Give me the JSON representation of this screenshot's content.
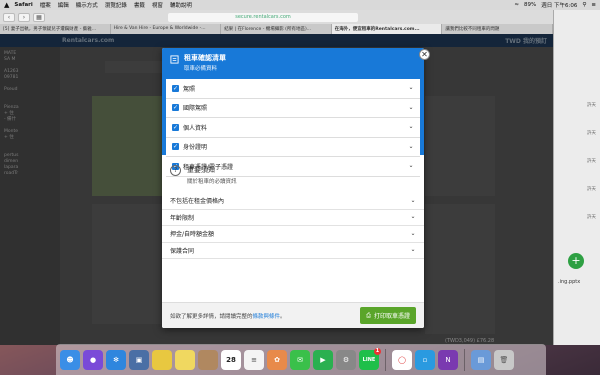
{
  "menubar": {
    "apple": "",
    "app": "Safari",
    "items": [
      "檔案",
      "編輯",
      "顯示方式",
      "瀏覽記錄",
      "書籤",
      "視窗",
      "輔助說明"
    ],
    "battery": "89%",
    "datetime": "週日 下午6:06"
  },
  "browser": {
    "url": "secure.rentalcars.com",
    "tabs": [
      "[5] 妻子出軌，男子懷疑兒子遭竊財產 - 藝雅...",
      "Hire & Van Hire - Europe & Worldwide -...",
      "結果 | 在Florence - 機場攝影 (所有地區)...",
      "在海外，便宜租車的Rentalcars.com...",
      "讓我們比較不同租車的問題"
    ],
    "active_tab": 3
  },
  "site": {
    "logo": "Rentalcars.com",
    "currency": "TWD 我的預訂",
    "left_text": [
      "MATE",
      "SA M",
      "A1263",
      "09781",
      "Pseud",
      "Pienza",
      "+ 住",
      "- 備什",
      "Monte",
      "+ 住",
      "pertus",
      "dimen",
      "lapara",
      "roadTr"
    ],
    "total": "(TWD3,049) £76.28"
  },
  "modal": {
    "header_title": "租車確認清單",
    "header_subtitle": "取車必備資料",
    "checklist": [
      {
        "label": "駕照"
      },
      {
        "label": "國際駕照"
      },
      {
        "label": "個人資料"
      },
      {
        "label": "身份證明"
      },
      {
        "label": "租車憑證/電子憑證"
      }
    ],
    "notice_title": "重要須知",
    "notice_subtitle": "關於租車的必讀資訊",
    "info_items": [
      {
        "label": "不包括在租金價格內"
      },
      {
        "label": "年齡限制"
      },
      {
        "label": "押金/自時額金額"
      },
      {
        "label": "保護合同"
      }
    ],
    "footer_text": "如欲了解更多詳情，請閱讀完整的",
    "footer_link": "條款與條件",
    "footer_tail": "。",
    "print_button": "打印取車憑證",
    "close": "✕"
  },
  "right_window": {
    "rows": [
      "許天",
      "許天",
      "許天",
      "許天",
      "許天"
    ],
    "file": ".ing.pptx"
  },
  "dock": {
    "icons": [
      {
        "name": "finder",
        "color": "#3a8ee6"
      },
      {
        "name": "siri",
        "color": "#7a4ad8"
      },
      {
        "name": "safari",
        "color": "#2e86de"
      },
      {
        "name": "preview",
        "color": "#4a6fa5"
      },
      {
        "name": "stickies",
        "color": "#e8c840"
      },
      {
        "name": "notes",
        "color": "#f0d860"
      },
      {
        "name": "contacts",
        "color": "#b08860"
      },
      {
        "name": "calendar",
        "color": "#ffffff"
      },
      {
        "name": "reminders",
        "color": "#f4f4f4"
      },
      {
        "name": "photos",
        "color": "#e88a4a"
      },
      {
        "name": "messages",
        "color": "#3ac04a"
      },
      {
        "name": "facetime",
        "color": "#2ab050"
      },
      {
        "name": "system-preferences",
        "color": "#888888"
      },
      {
        "name": "line",
        "color": "#1fbf4a"
      },
      {
        "name": "chrome",
        "color": "#ffffff"
      },
      {
        "name": "screen",
        "color": "#2a9ae0"
      },
      {
        "name": "onenote",
        "color": "#7a3ab0"
      },
      {
        "name": "folder",
        "color": "#6a9ad8"
      },
      {
        "name": "trash",
        "color": "#c8c8c8"
      }
    ],
    "calendar_day": "28",
    "line_label": "LINE",
    "line_badge": "1"
  }
}
